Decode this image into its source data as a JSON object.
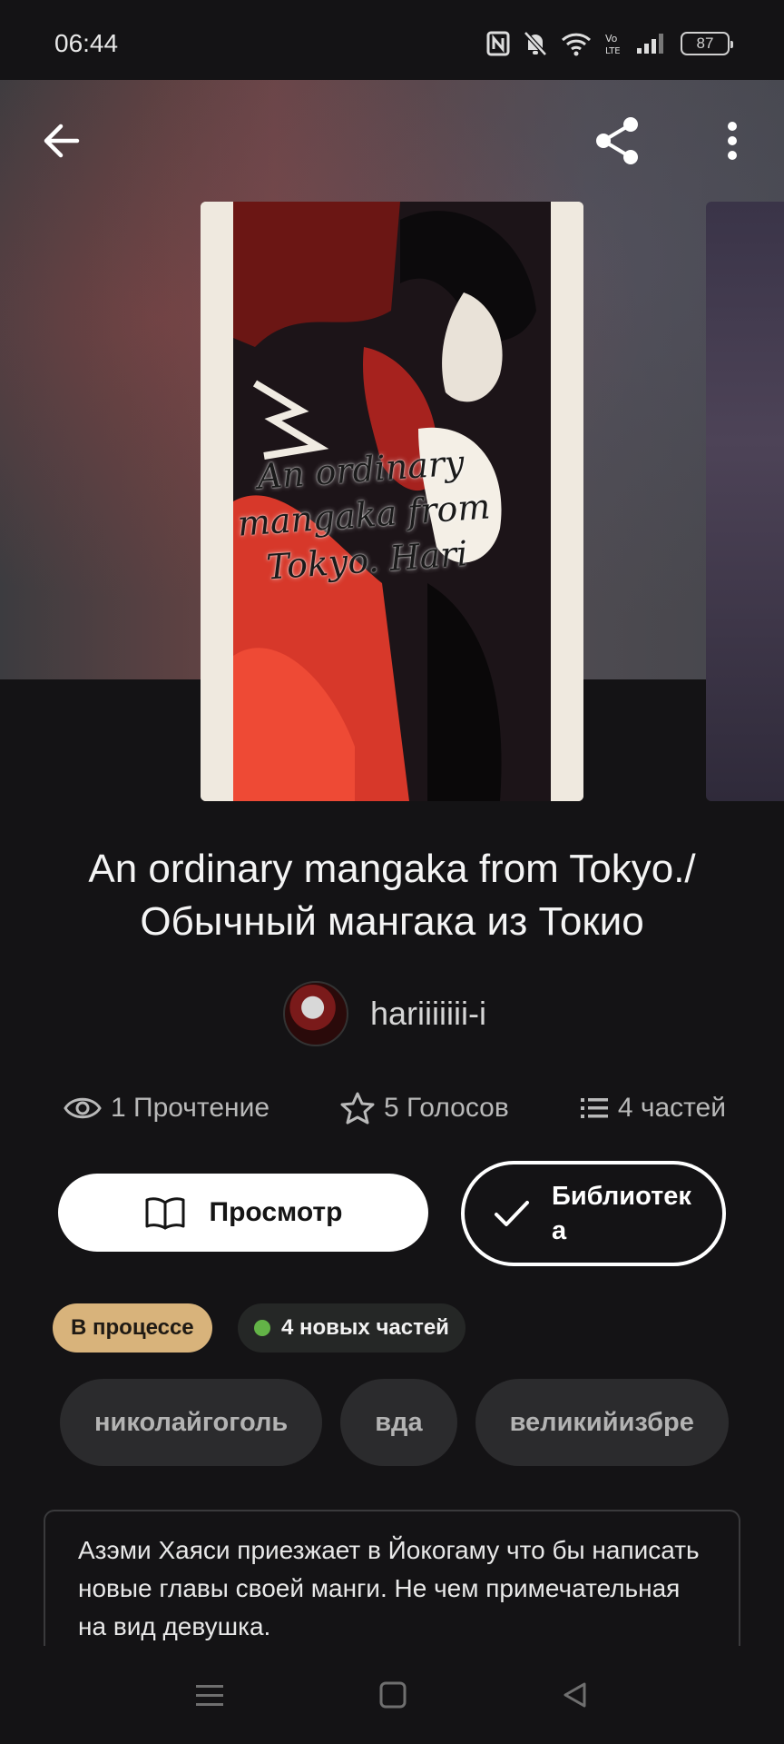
{
  "status_bar": {
    "time": "06:44",
    "battery": "87",
    "icons": [
      "nfc-icon",
      "mute-icon",
      "wifi-icon",
      "volte-icon",
      "signal-icon",
      "battery-icon"
    ]
  },
  "top_nav": {
    "back_icon": "arrow-left-icon",
    "share_icon": "share-icon",
    "more_icon": "more-vertical-icon"
  },
  "cover": {
    "title_text": "An ordinary mangaka from Tokyo. Hari"
  },
  "story": {
    "title": "An ordinary mangaka from Tokyo./ Обычный мангака из Токио",
    "author": "hariiiiiii-i"
  },
  "stats": {
    "reads": "1 Прочтение",
    "votes": "5 Голосов",
    "parts": "4 частей"
  },
  "actions": {
    "read_label": "Просмотр",
    "library_label": "Библиотек а"
  },
  "badges": {
    "status": "В процессе",
    "new_parts": "4 новых частей"
  },
  "tags": [
    "николайгоголь",
    "вда",
    "великийизбре"
  ],
  "description": "Азэми Хаяси приезжает в Йокогаму что бы написать новые главы своей манги. Не чем примечательная на вид девушка.",
  "colors": {
    "background": "#141315",
    "status_badge": "#d8b37b",
    "new_dot": "#63b347"
  }
}
